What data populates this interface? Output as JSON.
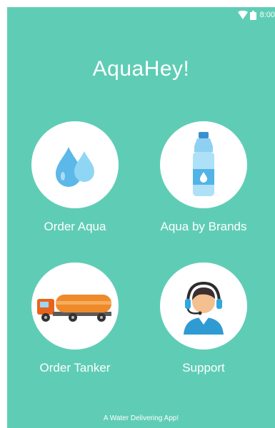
{
  "status_bar": {
    "time": "8:00",
    "icons": [
      "wifi-icon",
      "battery-icon"
    ]
  },
  "app": {
    "title": "AquaHey!",
    "tagline": "A Water Delivering App!"
  },
  "colors": {
    "background": "#5fcdb5",
    "tile_bg": "#ffffff",
    "text": "#ffffff"
  },
  "menu": [
    {
      "label": "Order Aqua",
      "icon": "water-drops-icon"
    },
    {
      "label": "Aqua by Brands",
      "icon": "water-bottle-icon"
    },
    {
      "label": "Order Tanker",
      "icon": "water-tanker-truck-icon"
    },
    {
      "label": "Support",
      "icon": "support-agent-headset-icon"
    }
  ]
}
